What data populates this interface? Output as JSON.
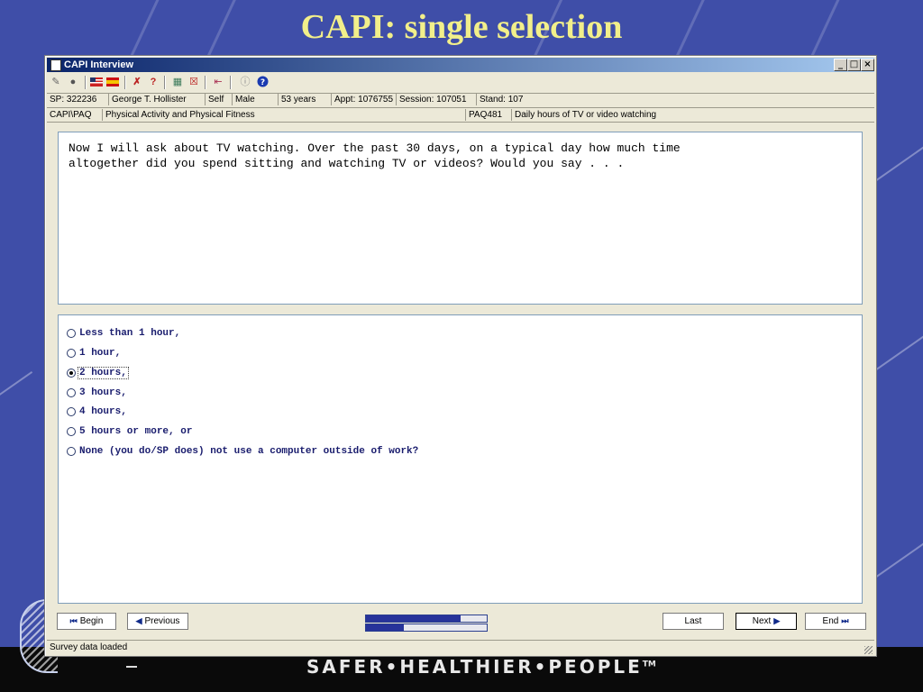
{
  "slide": {
    "title": "CAPI: single selection",
    "footer_slogan": "SAFER•HEALTHIER•PEOPLE",
    "footer_tm": "TM"
  },
  "window": {
    "title": "CAPI Interview",
    "controls": {
      "minimize": "_",
      "maximize": "□",
      "close": "×"
    }
  },
  "toolbar": {
    "icons": [
      "notes-icon",
      "person-icon",
      "us-flag-icon",
      "spain-flag-icon",
      "remove-icon",
      "question-mark-icon",
      "calculator-icon",
      "delete-icon",
      "exit-icon",
      "info-icon",
      "help-icon"
    ]
  },
  "info": {
    "sp": "SP: 322236",
    "name": "George T. Hollister",
    "relation": "Self",
    "sex": "Male",
    "age": "53 years",
    "appt": "Appt: 1076755",
    "session": "Session: 107051",
    "stand": "Stand: 107"
  },
  "section": {
    "path": "CAPI\\PAQ",
    "module": "Physical Activity and Physical Fitness",
    "code": "PAQ481",
    "description": "Daily hours of TV or video watching"
  },
  "question": {
    "line1": "Now I will ask about TV watching. Over the past 30 days, on a typical day how much time",
    "line2": "altogether did you spend sitting and watching TV or videos? Would you say . . ."
  },
  "answers": {
    "options": [
      "Less than 1 hour,",
      "1 hour,",
      "2 hours,",
      "3 hours,",
      "4 hours,",
      "5 hours or more, or",
      "None (you do/SP does) not use a computer outside of work?"
    ],
    "selected_index": 2
  },
  "nav": {
    "begin": "Begin",
    "previous": "Previous",
    "last": "Last",
    "next": "Next",
    "end": "End",
    "progress": [
      0.78,
      0.31
    ]
  },
  "status": {
    "text": "Survey data loaded"
  }
}
